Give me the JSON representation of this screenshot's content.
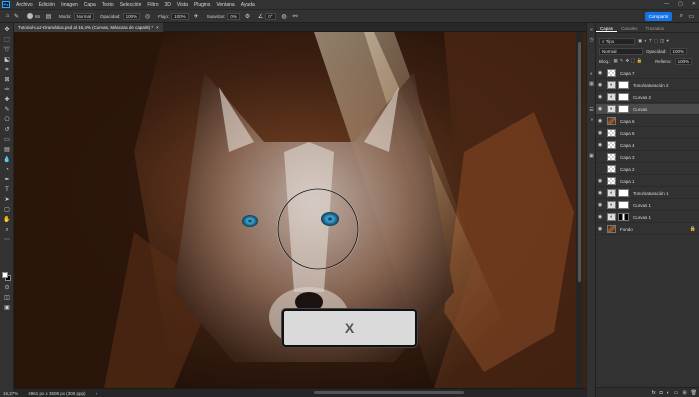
{
  "menubar": {
    "logo": "Ps",
    "items": [
      "Archivo",
      "Edición",
      "Imagen",
      "Capa",
      "Texto",
      "Selección",
      "Filtro",
      "3D",
      "Vista",
      "Plugins",
      "Ventana",
      "Ayuda"
    ],
    "window_controls": [
      "—",
      "▢",
      "✕"
    ]
  },
  "options": {
    "brush_size": "65",
    "mode_label": "Modo:",
    "mode_value": "Normal",
    "opacity_label": "Opacidad:",
    "opacity_value": "100%",
    "flow_label": "Flujo:",
    "flow_value": "100%",
    "smoothing_label": "Suavizar:",
    "smoothing_value": "0%",
    "angle_value": "0°",
    "share_label": "Compartir"
  },
  "document": {
    "tab_title": "Tutorial-Luz-Dramática.psd al 16,4% (Curvas, Máscara de capa/8) *",
    "close": "×"
  },
  "status": {
    "zoom": "16,27%",
    "doc_info": "4961 px x 3508 px (300 ppp)",
    "arrow": "›"
  },
  "panel": {
    "tabs": [
      "Capas",
      "Canales",
      "Trazados"
    ],
    "search_placeholder": "Tipo",
    "blend_mode": "Normal",
    "opacity_label": "Opacidad:",
    "opacity_value": "100%",
    "lock_label": "Bloq.:",
    "fill_label": "Relleno:",
    "fill_value": "100%",
    "layers": [
      {
        "name": "Capa 7",
        "kind": "transparent",
        "mask": false,
        "visible": true,
        "selected": false
      },
      {
        "name": "Tono/saturación 2",
        "kind": "adj",
        "mask": true,
        "visible": true,
        "selected": false
      },
      {
        "name": "Curvas 2",
        "kind": "adj",
        "mask": true,
        "visible": true,
        "selected": false
      },
      {
        "name": "Curvas",
        "kind": "adj",
        "mask": true,
        "visible": true,
        "selected": true
      },
      {
        "name": "Capa 6",
        "kind": "image",
        "mask": false,
        "visible": true,
        "selected": false
      },
      {
        "name": "Capa 5",
        "kind": "transparent",
        "mask": false,
        "visible": true,
        "selected": false
      },
      {
        "name": "Capa 4",
        "kind": "transparent",
        "mask": false,
        "visible": true,
        "selected": false
      },
      {
        "name": "Capa 3",
        "kind": "transparent",
        "mask": false,
        "visible": false,
        "selected": false
      },
      {
        "name": "Capa 2",
        "kind": "transparent",
        "mask": false,
        "visible": false,
        "selected": false
      },
      {
        "name": "Capa 1",
        "kind": "transparent",
        "mask": false,
        "visible": true,
        "selected": false
      },
      {
        "name": "Tono/saturación 1",
        "kind": "adj",
        "mask": true,
        "visible": true,
        "selected": false
      },
      {
        "name": "Curvas 1",
        "kind": "adj",
        "mask": true,
        "visible": true,
        "selected": false
      },
      {
        "name": "Curvas 1",
        "kind": "adj",
        "mask": true,
        "visible": true,
        "selected": false,
        "dark_mask": true
      },
      {
        "name": "Fondo",
        "kind": "image",
        "mask": false,
        "visible": true,
        "selected": false,
        "locked": true
      }
    ],
    "footer_icons": [
      "fx-icon",
      "mask-icon",
      "adjustment-icon",
      "group-icon",
      "new-layer-icon",
      "trash-icon"
    ]
  },
  "overlay": {
    "label": "X"
  },
  "colors": {
    "accent": "#1473e6",
    "foreground": "#ffffff",
    "background": "#000000"
  }
}
